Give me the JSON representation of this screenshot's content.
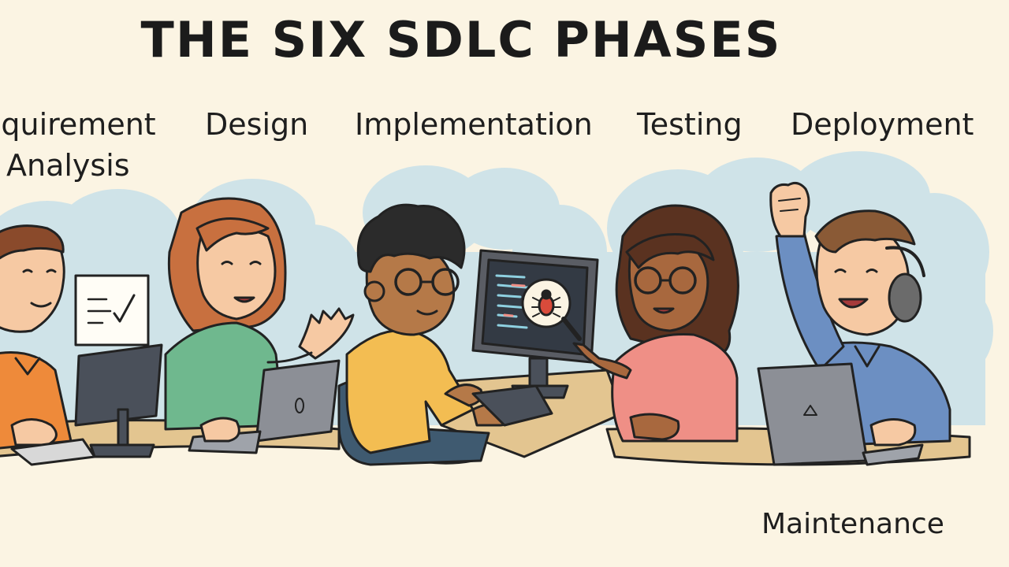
{
  "title": "THE SIX SDLC PHASES",
  "phases": {
    "requirement_line1": "equirement",
    "requirement_line2": "Analysis",
    "design": "Design",
    "implementation": "Implementation",
    "testing": "Testing",
    "deployment": "Deployment",
    "maintenance": "Maintenance"
  },
  "colors": {
    "background": "#fbf4e3",
    "cloud": "#cfe3e8",
    "desk": "#e3c590",
    "orange_shirt": "#ee8a3a",
    "green_shirt": "#6fb88e",
    "yellow_shirt": "#f3bd52",
    "pink_shirt": "#ef8f86",
    "blue_shirt": "#6c8fc2"
  },
  "icons": [
    "checklist-icon",
    "bug-icon",
    "magnifier-icon",
    "laptop-logo-icon"
  ]
}
